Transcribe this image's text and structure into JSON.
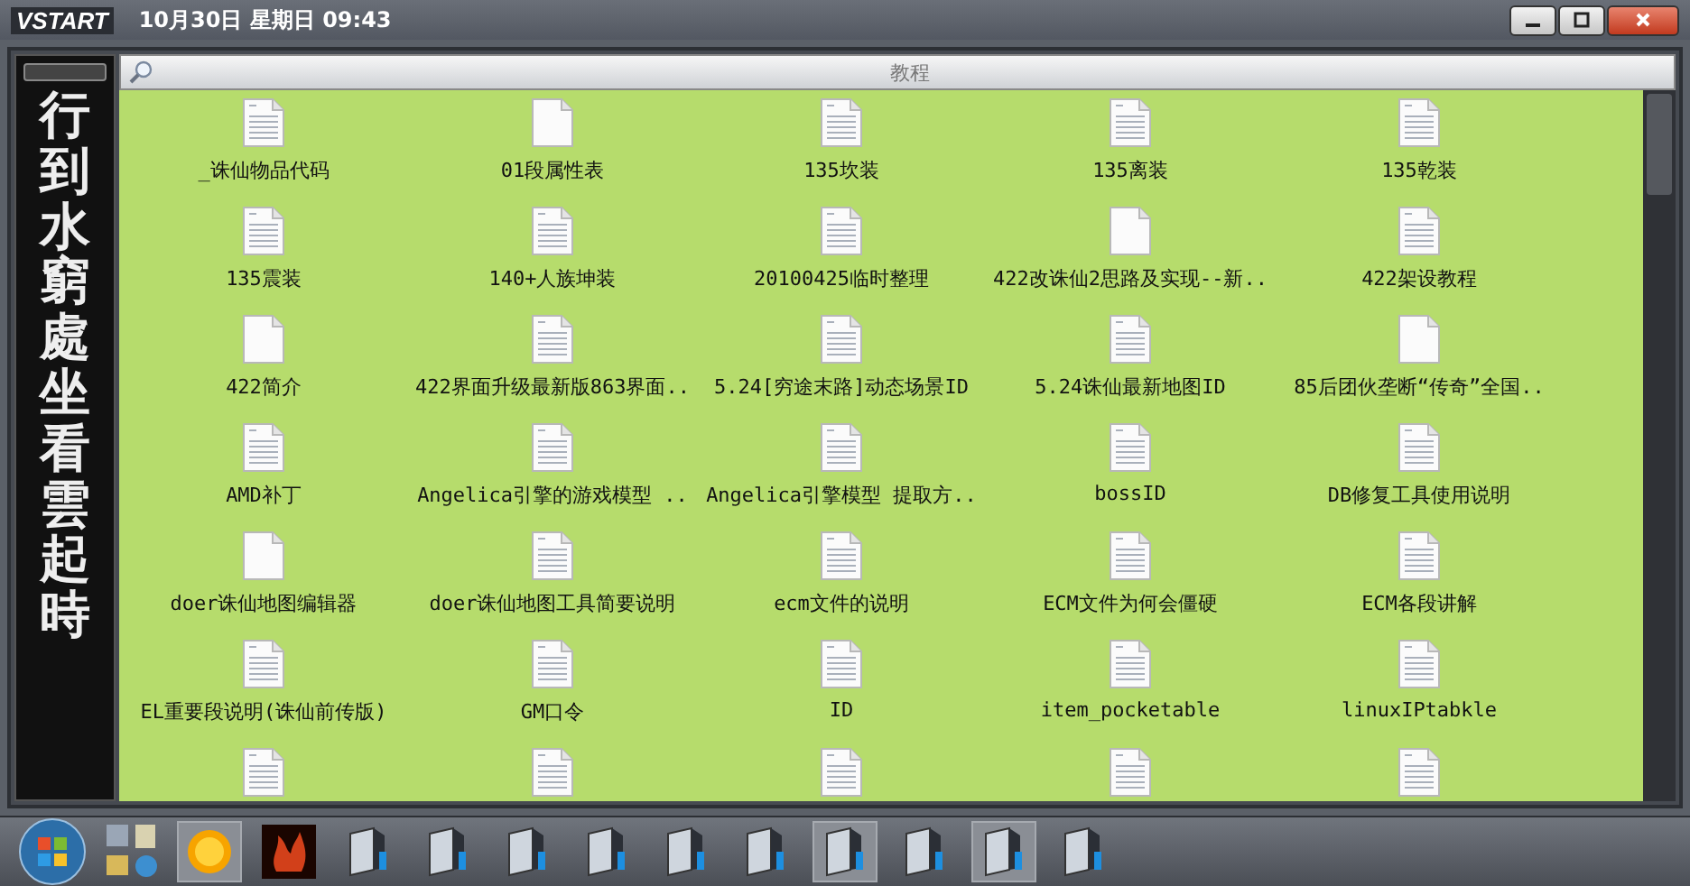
{
  "top_bar": {
    "logo": "VSTART",
    "datetime": "10月30日 星期日 09:43"
  },
  "side_panel": {
    "poem": "行到水窮處坐看雲起時"
  },
  "window": {
    "title": "教程"
  },
  "files": [
    {
      "label": "_诛仙物品代码",
      "kind": "text"
    },
    {
      "label": "01段属性表",
      "kind": "blank"
    },
    {
      "label": "135坎装",
      "kind": "text"
    },
    {
      "label": "135离装",
      "kind": "text"
    },
    {
      "label": "135乾装",
      "kind": "text"
    },
    {
      "label": "135震装",
      "kind": "text"
    },
    {
      "label": "140+人族坤装",
      "kind": "text"
    },
    {
      "label": "20100425临时整理",
      "kind": "text"
    },
    {
      "label": "422改诛仙2思路及实现--新..",
      "kind": "blank"
    },
    {
      "label": "422架设教程",
      "kind": "text"
    },
    {
      "label": "422简介",
      "kind": "blank"
    },
    {
      "label": "422界面升级最新版863界面..",
      "kind": "text"
    },
    {
      "label": "5.24[穷途末路]动态场景ID",
      "kind": "text"
    },
    {
      "label": "5.24诛仙最新地图ID",
      "kind": "text"
    },
    {
      "label": "85后团伙垄断“传奇”全国..",
      "kind": "blank"
    },
    {
      "label": "AMD补丁",
      "kind": "text"
    },
    {
      "label": "Angelica引擎的游戏模型 ..",
      "kind": "text"
    },
    {
      "label": "Angelica引擎模型 提取方..",
      "kind": "text"
    },
    {
      "label": "bossID",
      "kind": "text"
    },
    {
      "label": "DB修复工具使用说明",
      "kind": "text"
    },
    {
      "label": "doer诛仙地图编辑器",
      "kind": "blank"
    },
    {
      "label": "doer诛仙地图工具简要说明",
      "kind": "text"
    },
    {
      "label": "ecm文件的说明",
      "kind": "text"
    },
    {
      "label": "ECM文件为何会僵硬",
      "kind": "text"
    },
    {
      "label": "ECM各段讲解",
      "kind": "text"
    },
    {
      "label": "EL重要段说明(诛仙前传版)",
      "kind": "text"
    },
    {
      "label": "GM口令",
      "kind": "text"
    },
    {
      "label": "ID",
      "kind": "text"
    },
    {
      "label": "item_pocketable",
      "kind": "text"
    },
    {
      "label": "linuxIPtabkle",
      "kind": "text"
    }
  ],
  "cut_row": [
    {
      "kind": "text"
    },
    {
      "kind": "text"
    },
    {
      "kind": "text"
    },
    {
      "kind": "text"
    },
    {
      "kind": "text"
    }
  ],
  "taskbar": {
    "items": [
      {
        "kind": "sun",
        "selected": true
      },
      {
        "kind": "glyph",
        "selected": false
      },
      {
        "kind": "app",
        "selected": false
      },
      {
        "kind": "app",
        "selected": false
      },
      {
        "kind": "app",
        "selected": false
      },
      {
        "kind": "app",
        "selected": false
      },
      {
        "kind": "app",
        "selected": false
      },
      {
        "kind": "app",
        "selected": false
      },
      {
        "kind": "app",
        "selected": true
      },
      {
        "kind": "app",
        "selected": false
      },
      {
        "kind": "app",
        "selected": true
      },
      {
        "kind": "app",
        "selected": false
      }
    ]
  }
}
